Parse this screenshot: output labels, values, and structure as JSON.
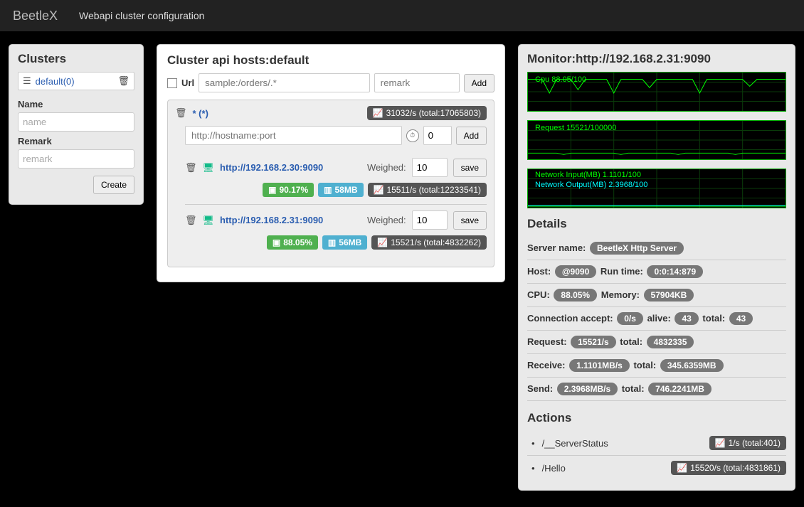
{
  "header": {
    "brand": "BeetleX",
    "subtitle": "Webapi cluster configuration"
  },
  "sidebar": {
    "title": "Clusters",
    "items": [
      {
        "label": "default(0)"
      }
    ],
    "name_label": "Name",
    "name_placeholder": "name",
    "remark_label": "Remark",
    "remark_placeholder": "remark",
    "create_btn": "Create"
  },
  "main": {
    "title": "Cluster api hosts:default",
    "url_label": "Url",
    "url_placeholder": "sample:/orders/.*",
    "remark_placeholder": "remark",
    "add_btn": "Add",
    "group": {
      "pattern": "* (*)",
      "stats": "31032/s (total:17065803)",
      "host_placeholder": "http://hostname:port",
      "interval_default": "0",
      "interval_add": "Add",
      "hosts": [
        {
          "url": "http://192.168.2.30:9090",
          "weighed_label": "Weighed:",
          "weighed": "10",
          "save_btn": "save",
          "cpu": "90.17%",
          "mem": "58MB",
          "stats": "15511/s (total:12233541)"
        },
        {
          "url": "http://192.168.2.31:9090",
          "weighed_label": "Weighed:",
          "weighed": "10",
          "save_btn": "save",
          "cpu": "88.05%",
          "mem": "56MB",
          "stats": "15521/s (total:4832262)"
        }
      ]
    }
  },
  "monitor": {
    "title": "Monitor:http://192.168.2.31:9090",
    "charts": {
      "cpu_label": "Cpu 88.05/100",
      "req_label": "Request 15521/100000",
      "net_in_label": "Network Input(MB) 1.1101/100",
      "net_out_label": "Network Output(MB) 2.3968/100"
    },
    "details_title": "Details",
    "details": {
      "server_name_k": "Server name:",
      "server_name_v": "BeetleX Http Server",
      "host_k": "Host:",
      "host_v": "@9090",
      "runtime_k": "Run time:",
      "runtime_v": "0:0:14:879",
      "cpu_k": "CPU:",
      "cpu_v": "88.05%",
      "memory_k": "Memory:",
      "memory_v": "57904KB",
      "conn_k": "Connection accept:",
      "conn_v": "0/s",
      "alive_k": "alive:",
      "alive_v": "43",
      "total_k": "total:",
      "total_v": "43",
      "req_k": "Request:",
      "req_v": "15521/s",
      "req_total_k": "total:",
      "req_total_v": "4832335",
      "recv_k": "Receive:",
      "recv_v": "1.1101MB/s",
      "recv_total_k": "total:",
      "recv_total_v": "345.6359MB",
      "send_k": "Send:",
      "send_v": "2.3968MB/s",
      "send_total_k": "total:",
      "send_total_v": "746.2241MB"
    },
    "actions_title": "Actions",
    "actions": [
      {
        "name": "/__ServerStatus",
        "stats": "1/s (total:401)"
      },
      {
        "name": "/Hello",
        "stats": "15520/s (total:4831861)"
      }
    ]
  },
  "chart_data": [
    {
      "type": "line",
      "title": "Cpu",
      "ylim": [
        0,
        100
      ],
      "value": 88.05,
      "series": [
        {
          "name": "Cpu",
          "values": [
            88,
            88,
            60,
            90,
            88,
            70,
            88,
            88,
            65,
            88,
            88,
            75,
            88,
            88,
            88,
            60,
            88,
            88,
            88,
            88
          ]
        }
      ]
    },
    {
      "type": "line",
      "title": "Request",
      "ylim": [
        0,
        100000
      ],
      "value": 15521,
      "series": [
        {
          "name": "Request",
          "values": [
            15500,
            15520,
            15510,
            15530,
            15520,
            15500,
            15520,
            15510,
            15530,
            15520,
            15510,
            15520,
            15500,
            15520,
            15520,
            15510,
            15520,
            15520,
            15521,
            15521
          ]
        }
      ]
    },
    {
      "type": "line",
      "title": "Network",
      "ylim": [
        0,
        100
      ],
      "series": [
        {
          "name": "Network Input(MB)",
          "value": 1.1101,
          "values": [
            1.1,
            1.1,
            1.1,
            1.1,
            1.1,
            1.1,
            1.1,
            1.1,
            1.1,
            1.1,
            1.1,
            1.1,
            1.1,
            1.1,
            1.1,
            1.1,
            1.1,
            1.1,
            1.1,
            1.1
          ]
        },
        {
          "name": "Network Output(MB)",
          "value": 2.3968,
          "values": [
            2.4,
            2.4,
            2.4,
            2.4,
            2.4,
            2.4,
            2.4,
            2.4,
            2.4,
            2.4,
            2.4,
            2.4,
            2.4,
            2.4,
            2.4,
            2.4,
            2.4,
            2.4,
            2.4,
            2.4
          ]
        }
      ]
    }
  ]
}
